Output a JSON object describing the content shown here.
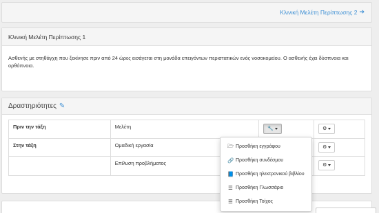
{
  "nav": {
    "next_link": "Κλινική Μελέτη Περίπτωσης 2",
    "next_icon": "arrow-right-icon"
  },
  "case": {
    "title": "Κλινική Μελέτη Περίπτωσης 1",
    "description": "Ασθενής με στηθάγχη που ξεκίνησε πριν από 24 ώρες εισάγεται στη μονάδα επειγόντων περιστατικών ενός νοσοκομείου. Ο ασθενής έχει δύσπνοια και ορθόπνοια."
  },
  "activities": {
    "heading": "Δραστηριότητες",
    "edit_icon": "pencil-icon",
    "rows": [
      {
        "phase": "Πριν την τάξη",
        "activity": "Μελέτη"
      },
      {
        "phase": "Στην τάξη",
        "activity": "Ομαδική εργασία"
      },
      {
        "phase": "",
        "activity": "Επίλυση προβλήματος"
      }
    ]
  },
  "menu": {
    "items": [
      {
        "label": "Προσθήκη εγγράφου",
        "icon": "folder-open-icon"
      },
      {
        "label": "Προσθήκη συνδέσμου",
        "icon": "link-icon"
      },
      {
        "label": "Προσθήκη ηλεκτρονικού βιβλίου",
        "icon": "book-icon"
      },
      {
        "label": "Προσθήκη Γλωσσάριο",
        "icon": "list-icon"
      },
      {
        "label": "Προσθήκη Τοίχος",
        "icon": "list-icon"
      }
    ]
  },
  "colors": {
    "link": "#3d8fd4",
    "panel_heading": "#f5f5f5",
    "border": "#dddddd"
  }
}
